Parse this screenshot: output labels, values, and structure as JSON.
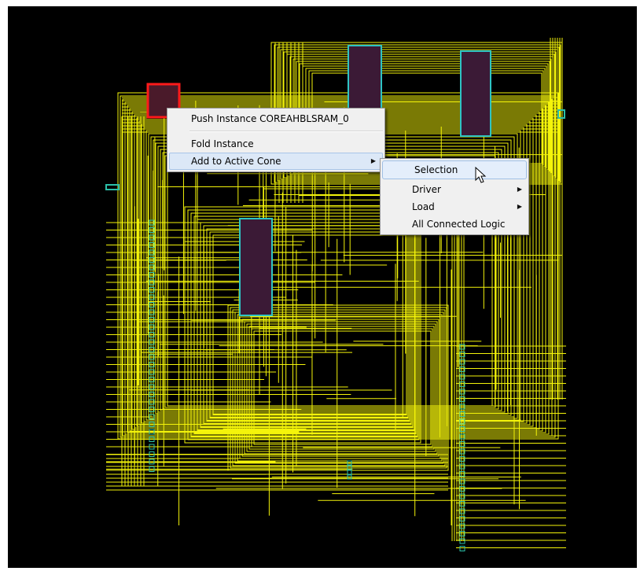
{
  "colors": {
    "canvas_bg": "#000000",
    "net_wire": "#f4f40a",
    "instance_fill": "#3b1a36",
    "instance_border": "#2ec4c4",
    "selected_instance_border": "#ff1a1a",
    "port_color": "#2bbfa8"
  },
  "context_menu": {
    "items": [
      {
        "label": "Push Instance COREAHBLSRAM_0",
        "has_submenu": false
      },
      {
        "label": "Fold Instance",
        "has_submenu": false
      },
      {
        "label": "Add to Active Cone",
        "has_submenu": true,
        "highlighted": true
      }
    ]
  },
  "submenu": {
    "items": [
      {
        "label": "Selection",
        "has_submenu": false,
        "highlighted": true
      },
      {
        "label": "Driver",
        "has_submenu": true
      },
      {
        "label": "Load",
        "has_submenu": true
      },
      {
        "label": "All Connected Logic",
        "has_submenu": false
      }
    ]
  },
  "icons": {
    "submenu_arrow": "triangle-right-icon",
    "cursor": "arrow-pointer-icon"
  }
}
